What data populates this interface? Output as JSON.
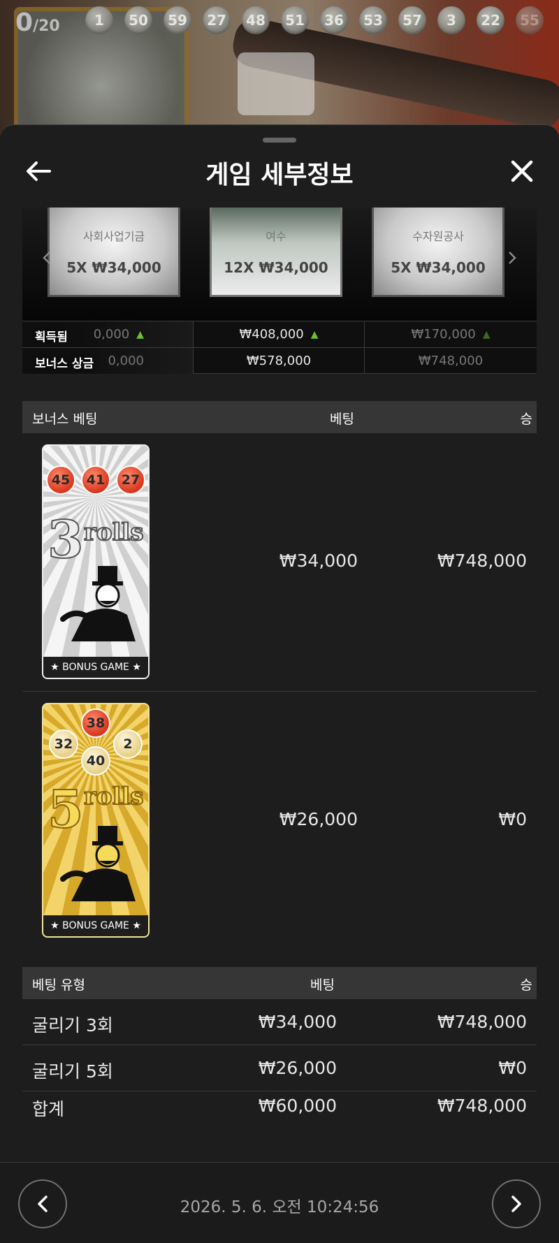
{
  "top": {
    "counter_value": "0",
    "counter_total": "/20",
    "drawn_balls": [
      "1",
      "50",
      "59",
      "27",
      "48",
      "51",
      "36",
      "53",
      "57",
      "3",
      "22",
      "55"
    ]
  },
  "header": {
    "title": "게임 세부정보",
    "back_icon": "arrow-left-icon",
    "close_icon": "close-icon"
  },
  "carousel": {
    "cards": [
      {
        "name": "사회사업기금",
        "value": "5X ₩34,000"
      },
      {
        "name": "여수",
        "value": "12X ₩34,000"
      },
      {
        "name": "수자원공사",
        "value": "5X ₩34,000"
      }
    ]
  },
  "stats": {
    "won_label": "획득됨",
    "bonus_label": "보너스 상금",
    "won_values": [
      "0,000",
      "₩408,000",
      "₩170,000"
    ],
    "bonus_values": [
      "0,000",
      "₩578,000",
      "₩748,000"
    ]
  },
  "bonus_table": {
    "headers": {
      "type": "보너스 베팅",
      "bet": "베팅",
      "win": "승"
    },
    "rows": [
      {
        "card_balls": [
          "45",
          "41",
          "27"
        ],
        "roll_count": "3",
        "roll_word": "rolls",
        "badge": "★ BONUS GAME ★",
        "bet": "₩34,000",
        "win": "₩748,000"
      },
      {
        "card_balls": [
          "38",
          "32",
          "2",
          "40"
        ],
        "roll_count": "5",
        "roll_word": "rolls",
        "badge": "★ BONUS GAME ★",
        "bet": "₩26,000",
        "win": "₩0"
      }
    ]
  },
  "summary_table": {
    "headers": {
      "type": "베팅 유형",
      "bet": "베팅",
      "win": "승"
    },
    "rows": [
      {
        "type": "굴리기 3회",
        "bet": "₩34,000",
        "win": "₩748,000"
      },
      {
        "type": "굴리기 5회",
        "bet": "₩26,000",
        "win": "₩0"
      },
      {
        "type": "합계",
        "bet": "₩60,000",
        "win": "₩748,000"
      }
    ]
  },
  "footer": {
    "timestamp": "2026. 5. 6. 오전 10:24:56",
    "prev_icon": "chevron-left-icon",
    "next_icon": "chevron-right-icon"
  }
}
